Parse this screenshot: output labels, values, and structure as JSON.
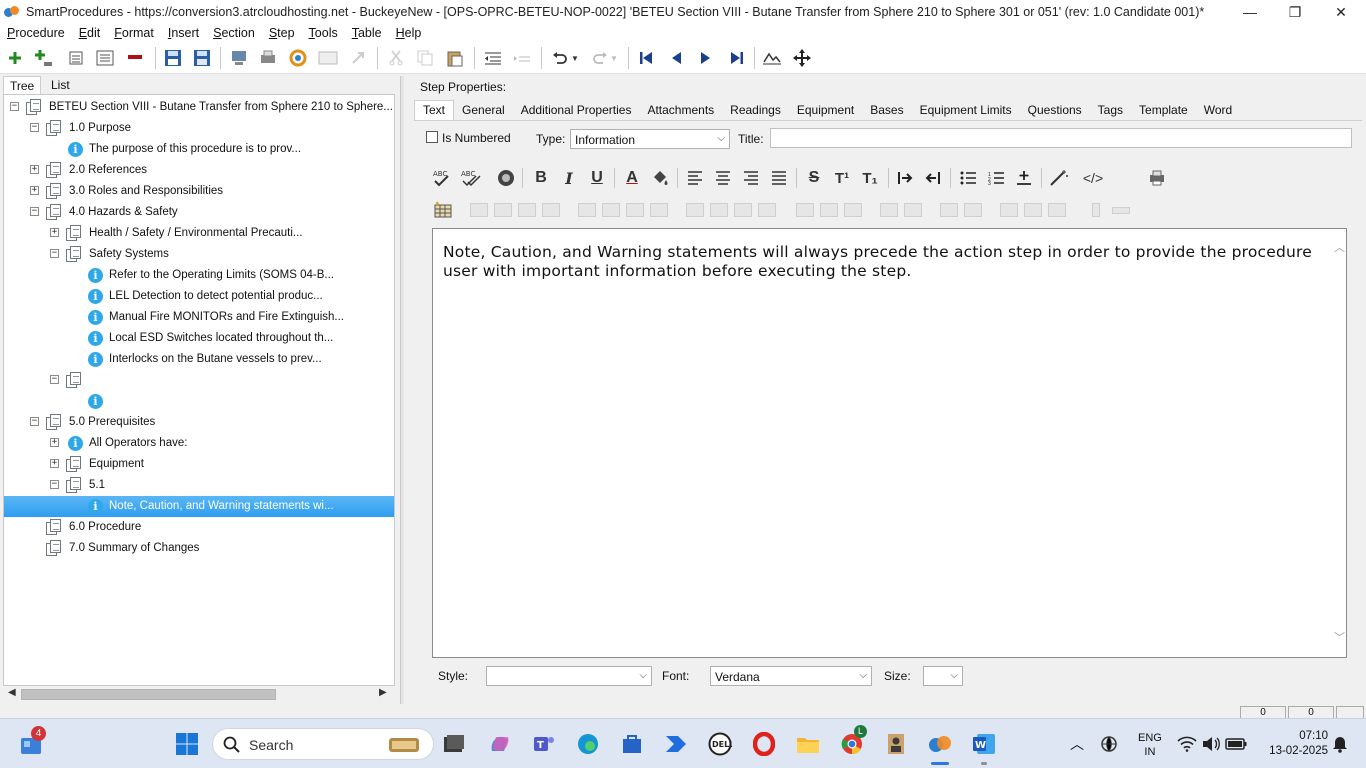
{
  "window": {
    "title": "SmartProcedures - https://conversion3.atrcloudhosting.net - BuckeyeNew - [OPS-OPRC-BETEU-NOP-0022] 'BETEU Section VIII - Butane Transfer from Sphere 210 to Sphere 301 or 051' (rev: 1.0 Candidate 001)*",
    "minimize": "—",
    "restore": "❐",
    "close": "✕"
  },
  "menu": [
    {
      "label": "Procedure"
    },
    {
      "label": "Edit"
    },
    {
      "label": "Format"
    },
    {
      "label": "Insert"
    },
    {
      "label": "Section"
    },
    {
      "label": "Step"
    },
    {
      "label": "Tools"
    },
    {
      "label": "Table"
    },
    {
      "label": "Help"
    }
  ],
  "left_tabs": {
    "tree": "Tree",
    "list": "List"
  },
  "tree": [
    {
      "label": "BETEU Section VIII - Butane Transfer from Sphere 210 to Sphere...",
      "icon": "page",
      "expander": "−"
    },
    {
      "label": "1.0 Purpose",
      "icon": "page",
      "expander": "−"
    },
    {
      "label": "The purpose of this procedure is to prov...",
      "icon": "info",
      "expander": ""
    },
    {
      "label": "2.0 References",
      "icon": "page",
      "expander": "+"
    },
    {
      "label": "3.0 Roles and Responsibilities",
      "icon": "page",
      "expander": "+"
    },
    {
      "label": "4.0 Hazards & Safety",
      "icon": "page",
      "expander": "−"
    },
    {
      "label": "Health / Safety / Environmental Precauti...",
      "icon": "page",
      "expander": "+"
    },
    {
      "label": "Safety Systems",
      "icon": "page",
      "expander": "−"
    },
    {
      "label": "Refer to the Operating Limits (SOMS 04-B...",
      "icon": "info",
      "expander": ""
    },
    {
      "label": "LEL Detection to detect potential produc...",
      "icon": "info",
      "expander": ""
    },
    {
      "label": "Manual Fire MONITORs and Fire Extinguish...",
      "icon": "info",
      "expander": ""
    },
    {
      "label": "Local ESD Switches located throughout th...",
      "icon": "info",
      "expander": ""
    },
    {
      "label": "Interlocks on the Butane vessels to prev...",
      "icon": "info",
      "expander": ""
    },
    {
      "label": "",
      "icon": "page",
      "expander": "−"
    },
    {
      "label": "",
      "icon": "info",
      "expander": ""
    },
    {
      "label": "5.0 Prerequisites",
      "icon": "page",
      "expander": "−"
    },
    {
      "label": "All Operators have:",
      "icon": "info",
      "expander": "+"
    },
    {
      "label": "Equipment",
      "icon": "page",
      "expander": "+"
    },
    {
      "label": "5.1",
      "icon": "page",
      "expander": "−"
    },
    {
      "label": "Note, Caution, and Warning statements wi...",
      "icon": "info",
      "expander": "",
      "selected": true
    },
    {
      "label": "6.0 Procedure",
      "icon": "page",
      "expander": ""
    },
    {
      "label": "7.0 Summary of Changes",
      "icon": "page",
      "expander": ""
    }
  ],
  "step_properties": {
    "heading": "Step Properties:",
    "tabs": [
      "Text",
      "General",
      "Additional Properties",
      "Attachments",
      "Readings",
      "Equipment",
      "Bases",
      "Equipment Limits",
      "Questions",
      "Tags",
      "Template",
      "Word"
    ],
    "is_numbered_label": "Is Numbered",
    "type_label": "Type:",
    "type_value": "Information",
    "title_label": "Title:",
    "title_value": "",
    "editor_text": "Note, Caution, and Warning statements will always precede the action step in order to provide the procedure user with important information before executing the step.",
    "style_label": "Style:",
    "style_value": "",
    "font_label": "Font:",
    "font_value": "Verdana",
    "size_label": "Size:",
    "size_value": ""
  },
  "format_toolbar": {
    "bold": "B",
    "italic": "I",
    "underline": "U",
    "font_color": "A",
    "strike": "S",
    "superscript": "T¹",
    "subscript": "T₁",
    "html": "</>"
  },
  "statusbar": {
    "cell1": "0",
    "cell2": "0"
  },
  "taskbar": {
    "widget_badge": "4",
    "search_label": "Search",
    "chrome_badge": "L",
    "lang": "ENG",
    "region": "IN",
    "time": "07:10",
    "date": "13-02-2025"
  },
  "colors": {
    "accent": "#2f9df0",
    "info_icon": "#2fa8ea",
    "taskbar": "#dde6f2"
  }
}
